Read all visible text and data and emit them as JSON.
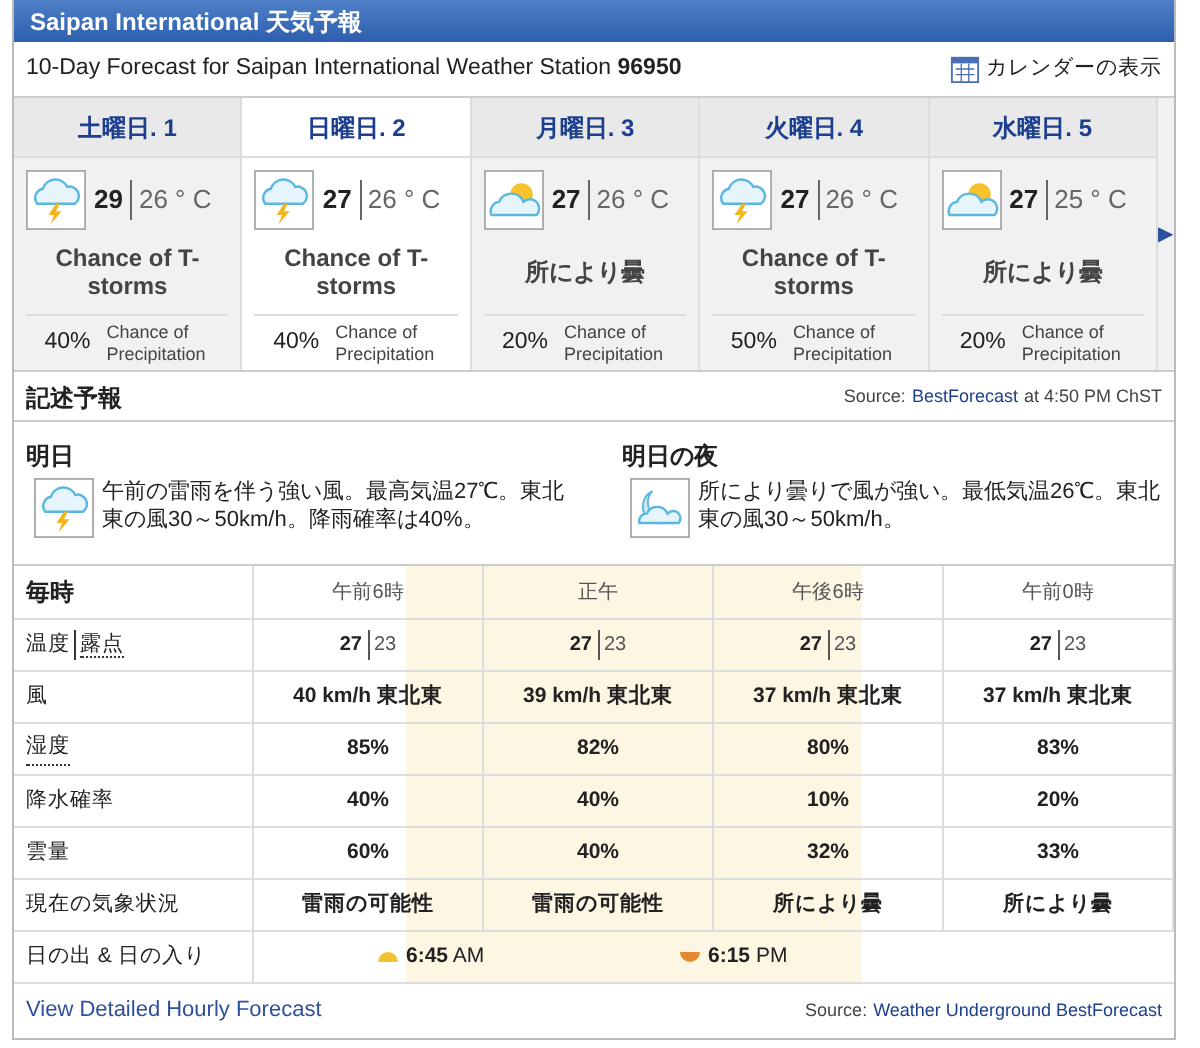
{
  "header": {
    "title": "Saipan International 天気予報"
  },
  "station": {
    "text": "10-Day Forecast for Saipan International Weather Station",
    "id": "96950",
    "calendar_link": "カレンダーの表示"
  },
  "days": [
    {
      "label": "土曜日. 1",
      "selected": false,
      "kind": "tstorm",
      "high": "29",
      "low": "26 ° C",
      "condition": "Chance of T-storms",
      "pop": "40%",
      "pop_label": "Chance of Precipitation"
    },
    {
      "label": "日曜日. 2",
      "selected": true,
      "kind": "tstorm",
      "high": "27",
      "low": "26 ° C",
      "condition": "Chance of T-storms",
      "pop": "40%",
      "pop_label": "Chance of Precipitation"
    },
    {
      "label": "月曜日. 3",
      "selected": false,
      "kind": "partly-cloudy",
      "high": "27",
      "low": "26 ° C",
      "condition": "所により曇",
      "pop": "20%",
      "pop_label": "Chance of Precipitation"
    },
    {
      "label": "火曜日. 4",
      "selected": false,
      "kind": "tstorm",
      "high": "27",
      "low": "26 ° C",
      "condition": "Chance of T-storms",
      "pop": "50%",
      "pop_label": "Chance of Precipitation"
    },
    {
      "label": "水曜日. 5",
      "selected": false,
      "kind": "partly-cloudy",
      "high": "27",
      "low": "25 ° C",
      "condition": "所により曇",
      "pop": "20%",
      "pop_label": "Chance of Precipitation"
    }
  ],
  "next_arrow": "▶",
  "narrative": {
    "title": "記述予報",
    "source_label": "Source:",
    "source_link": "BestForecast",
    "source_time": "at 4:50 PM ChST",
    "periods": [
      {
        "title": "明日",
        "kind": "tstorm",
        "text": "午前の雷雨を伴う強い風。最高気温27℃。東北東の風30～50km/h。降雨確率は40%。"
      },
      {
        "title": "明日の夜",
        "kind": "night-cloudy",
        "text": "所により曇りで風が強い。最低気温26℃。東北東の風30～50km/h。"
      }
    ]
  },
  "hourly": {
    "title": "毎時",
    "columns": [
      "午前6時",
      "正午",
      "午後6時",
      "午前0時"
    ],
    "rows": [
      {
        "kind": "pair",
        "label": "温度",
        "label2": "露点",
        "cells": [
          [
            "27",
            "23"
          ],
          [
            "27",
            "23"
          ],
          [
            "27",
            "23"
          ],
          [
            "27",
            "23"
          ]
        ]
      },
      {
        "kind": "plain",
        "label": "風",
        "cells": [
          "40 km/h 東北東",
          "39 km/h 東北東",
          "37 km/h 東北東",
          "37 km/h 東北東"
        ]
      },
      {
        "kind": "underlined",
        "label": "湿度",
        "cells": [
          "85%",
          "82%",
          "80%",
          "83%"
        ]
      },
      {
        "kind": "plain",
        "label": "降水確率",
        "cells": [
          "40%",
          "40%",
          "10%",
          "20%"
        ]
      },
      {
        "kind": "plain",
        "label": "雲量",
        "cells": [
          "60%",
          "40%",
          "32%",
          "33%"
        ]
      },
      {
        "kind": "plain",
        "label": "現在の気象状況",
        "cells": [
          "雷雨の可能性",
          "雷雨の可能性",
          "所により曇",
          "所により曇"
        ]
      }
    ],
    "sun": {
      "label": "日の出 & 日の入り",
      "sunrise": "6:45",
      "sunrise_suffix": "AM",
      "sunset": "6:15",
      "sunset_suffix": "PM"
    }
  },
  "footer": {
    "link": "View Detailed Hourly Forecast",
    "source_label": "Source:",
    "source_link": "Weather Underground BestForecast"
  }
}
